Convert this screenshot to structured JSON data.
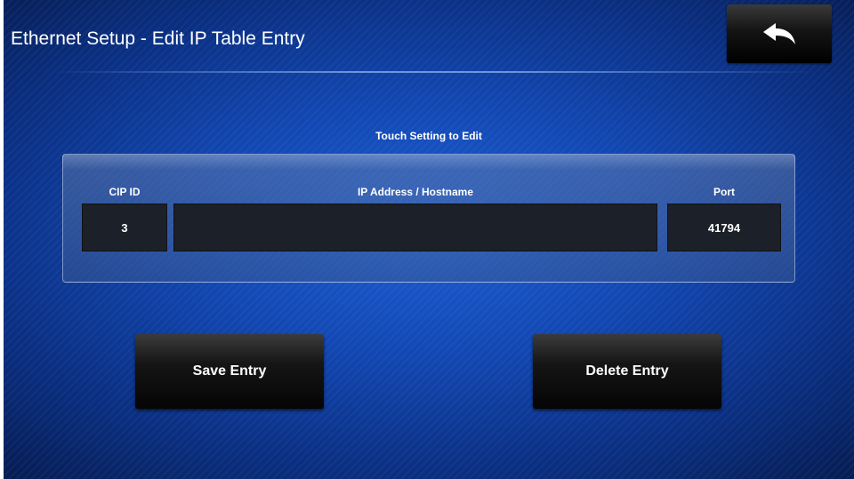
{
  "header": {
    "title": "Ethernet Setup - Edit IP Table Entry",
    "back_icon": "back-arrow-icon"
  },
  "main": {
    "instruction": "Touch Setting to Edit",
    "table": {
      "columns": {
        "cip_id": "CIP ID",
        "ip_address": "IP Address / Hostname",
        "port": "Port"
      },
      "entry": {
        "cip_id": "3",
        "ip_address": "",
        "port": "41794"
      }
    },
    "actions": {
      "save_label": "Save Entry",
      "delete_label": "Delete Entry"
    }
  },
  "colors": {
    "background": "#1247b2",
    "button": "#151515",
    "cell": "#1c2028",
    "text": "#ffffff"
  }
}
